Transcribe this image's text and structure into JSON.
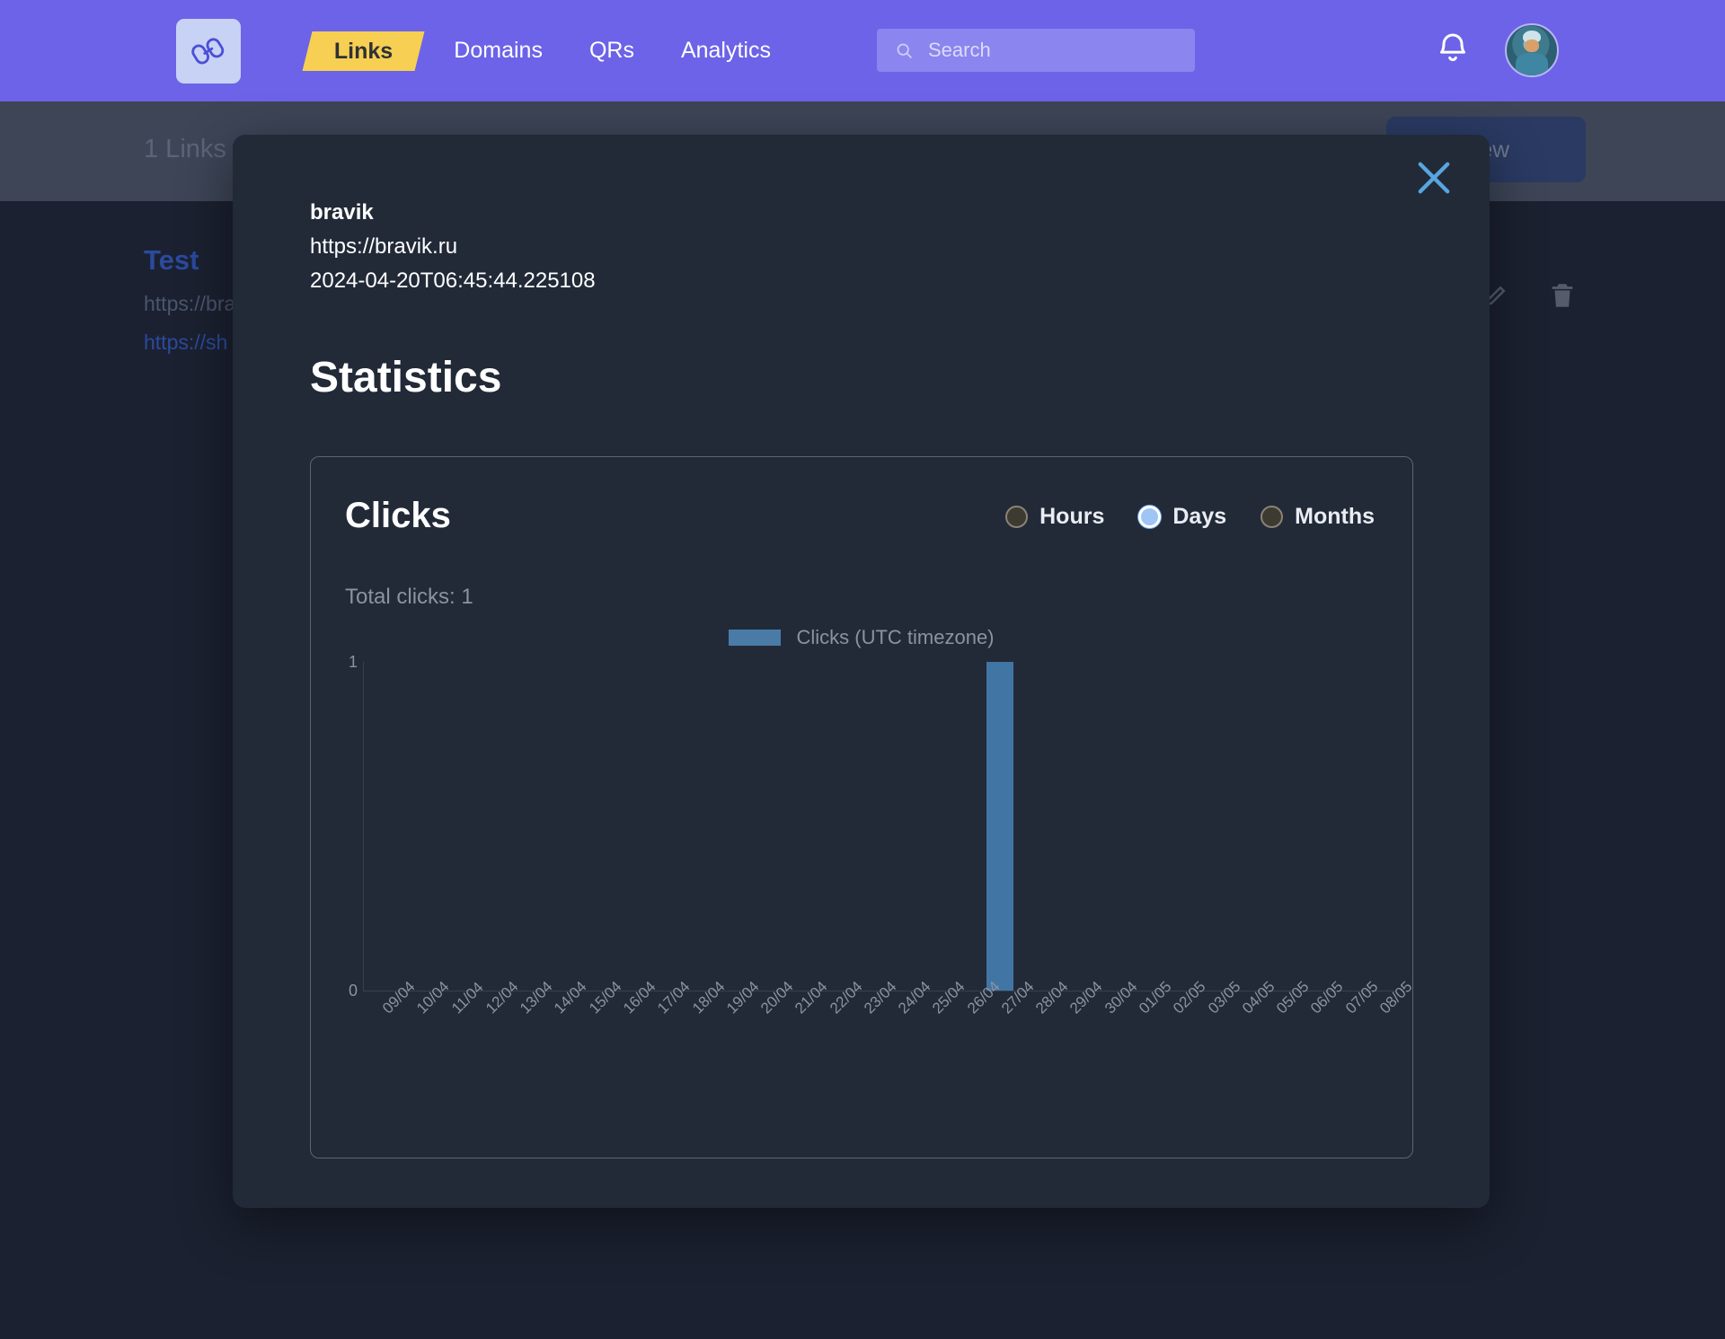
{
  "nav": {
    "logo_icon": "link-chain-icon",
    "tabs": [
      {
        "label": "Links",
        "active": true
      },
      {
        "label": "Domains",
        "active": false
      },
      {
        "label": "QRs",
        "active": false
      },
      {
        "label": "Analytics",
        "active": false
      }
    ],
    "search": {
      "placeholder": "Search",
      "value": "",
      "icon": "search-icon"
    },
    "bell_icon": "bell-icon",
    "avatar": "user-avatar",
    "accent_bg": "#6c63e8",
    "active_tab_bg": "#f6cf53"
  },
  "background": {
    "subheader_title": "1 Links",
    "new_button_label": "New",
    "link_title": "Test",
    "link_url_1": "https://bra",
    "link_url_2": "https://sh",
    "edit_icon": "pencil-icon",
    "delete_icon": "trash-icon"
  },
  "modal": {
    "close_icon": "close-icon",
    "close_color": "#57a6e0",
    "name": "bravik",
    "url": "https://bravik.ru",
    "created_at": "2024-04-20T06:45:44.225108",
    "section_title": "Statistics"
  },
  "card": {
    "title": "Clicks",
    "total_clicks_label": "Total clicks: 1",
    "granularity": [
      {
        "label": "Hours",
        "selected": false
      },
      {
        "label": "Days",
        "selected": true
      },
      {
        "label": "Months",
        "selected": false
      }
    ]
  },
  "chart_data": {
    "type": "bar",
    "title": "Clicks",
    "xlabel": "",
    "ylabel": "",
    "ylim": [
      0,
      1
    ],
    "yticks": [
      "0",
      "1"
    ],
    "grid": false,
    "legend_position": "top-center",
    "series": [
      {
        "name": "Clicks (UTC timezone)",
        "color": "#4176a4",
        "values": [
          0,
          0,
          0,
          0,
          0,
          0,
          0,
          0,
          0,
          0,
          0,
          0,
          0,
          0,
          0,
          0,
          0,
          0,
          1,
          0,
          0,
          0,
          0,
          0,
          0,
          0,
          0,
          0,
          0,
          0
        ]
      }
    ],
    "categories": [
      "09/04",
      "10/04",
      "11/04",
      "12/04",
      "13/04",
      "14/04",
      "15/04",
      "16/04",
      "17/04",
      "18/04",
      "19/04",
      "20/04",
      "21/04",
      "22/04",
      "23/04",
      "24/04",
      "25/04",
      "26/04",
      "27/04",
      "28/04",
      "29/04",
      "30/04",
      "01/05",
      "02/05",
      "03/05",
      "04/05",
      "05/05",
      "06/05",
      "07/05",
      "08/05"
    ]
  }
}
